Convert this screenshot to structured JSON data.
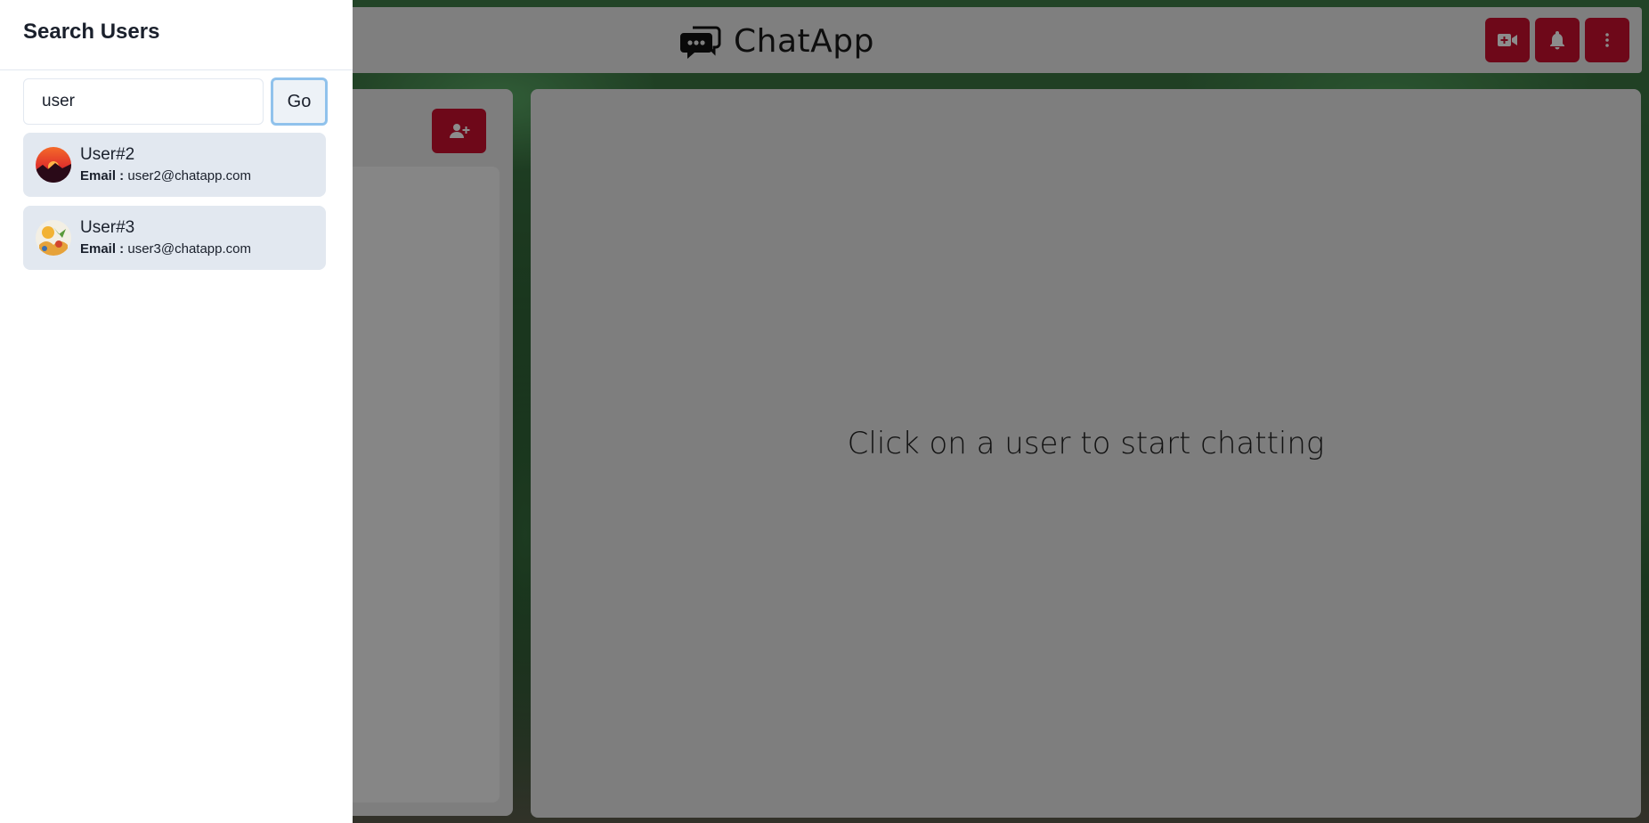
{
  "header": {
    "brand_title": "ChatApp",
    "buttons": [
      {
        "name": "video-call-button",
        "icon": "video-plus-icon"
      },
      {
        "name": "notifications-button",
        "icon": "bell-icon"
      },
      {
        "name": "more-menu-button",
        "icon": "more-vertical-icon"
      }
    ],
    "accent_color": "#c8102e"
  },
  "left_panel": {
    "add_user_icon": "user-plus-icon"
  },
  "main": {
    "placeholder_text": "Click on a user to start chatting"
  },
  "drawer": {
    "title": "Search Users",
    "search": {
      "value": "user",
      "go_label": "Go"
    },
    "results": [
      {
        "name": "User#2",
        "email_label": "Email :",
        "email": "user2@chatapp.com",
        "avatar": "sunset-avatar"
      },
      {
        "name": "User#3",
        "email_label": "Email :",
        "email": "user3@chatapp.com",
        "avatar": "illustration-avatar"
      }
    ]
  }
}
